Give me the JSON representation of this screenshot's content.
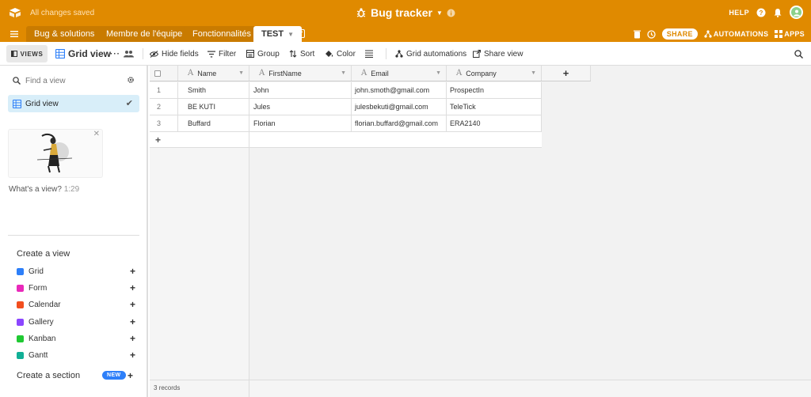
{
  "header": {
    "save_status": "All changes saved",
    "base_title": "Bug tracker",
    "help_label": "HELP"
  },
  "tabs": [
    {
      "label": "Bug & solutions"
    },
    {
      "label": "Membre de l'équipe"
    },
    {
      "label": "Fonctionnalités"
    },
    {
      "label": "TEST"
    }
  ],
  "tabbar_right": {
    "share_label": "SHARE",
    "automations_label": "AUTOMATIONS",
    "apps_label": "APPS"
  },
  "toolbar": {
    "views_label": "VIEWS",
    "view_name": "Grid view",
    "hide_fields": "Hide fields",
    "filter": "Filter",
    "group": "Group",
    "sort": "Sort",
    "color": "Color",
    "grid_automations": "Grid automations",
    "share_view": "Share view"
  },
  "sidebar": {
    "find_placeholder": "Find a view",
    "selected_view": "Grid view",
    "video_caption": "What's a view?",
    "video_duration": "1:29",
    "create_view_heading": "Create a view",
    "create_items": [
      {
        "label": "Grid",
        "color": "#2d7ff9"
      },
      {
        "label": "Form",
        "color": "#e929ba"
      },
      {
        "label": "Calendar",
        "color": "#f82b60"
      },
      {
        "label": "Gallery",
        "color": "#8b46ff"
      },
      {
        "label": "Kanban",
        "color": "#20c933"
      },
      {
        "label": "Gantt",
        "color": "#11af96"
      }
    ],
    "create_section": "Create a section",
    "new_badge": "NEW"
  },
  "grid": {
    "columns": [
      "Name",
      "FirstName",
      "Email",
      "Company"
    ],
    "rows": [
      {
        "num": "1",
        "name": "Smith",
        "first": "John",
        "email": "john.smoth@gmail.com",
        "company": "ProspectIn"
      },
      {
        "num": "2",
        "name": "BE KUTI",
        "first": "Jules",
        "email": "julesbekuti@gmail.com",
        "company": "TeleTick"
      },
      {
        "num": "3",
        "name": "Buffard",
        "first": "Florian",
        "email": "florian.buffard@gmail.com",
        "company": "ERA2140"
      }
    ],
    "record_count": "3 records"
  }
}
